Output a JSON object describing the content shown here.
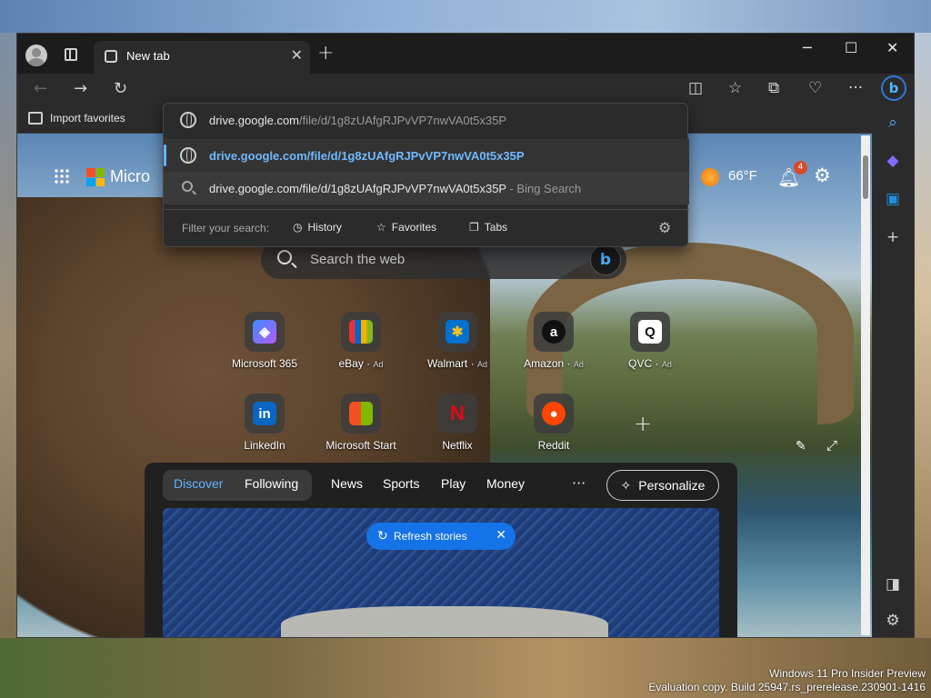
{
  "tab": {
    "title": "New tab"
  },
  "omnibox": {
    "typed_host": "drive.google.com",
    "typed_path": "/file/d/1g8zUAfgRJPvVP7nwVA0t5x35P",
    "suggestion_url": "drive.google.com/file/d/1g8zUAfgRJPvVP7nwVA0t5x35P",
    "search_text": "drive.google.com/file/d/1g8zUAfgRJPvVP7nwVA0t5x35P",
    "search_suffix": " - Bing Search",
    "filter_label": "Filter your search:",
    "filters": [
      "History",
      "Favorites",
      "Tabs"
    ]
  },
  "favorites_bar": {
    "import_label": "Import favorites"
  },
  "newtab": {
    "brand": "Micro",
    "temperature": "66°F",
    "notifications": "4",
    "search_placeholder": "Search the web",
    "quick_links": [
      {
        "label": "Microsoft 365",
        "ad": ""
      },
      {
        "label": "eBay",
        "ad": "Ad"
      },
      {
        "label": "Walmart",
        "ad": "Ad"
      },
      {
        "label": "Amazon",
        "ad": "Ad"
      },
      {
        "label": "QVC",
        "ad": "Ad"
      },
      {
        "label": "LinkedIn",
        "ad": ""
      },
      {
        "label": "Microsoft Start",
        "ad": ""
      },
      {
        "label": "Netflix",
        "ad": ""
      },
      {
        "label": "Reddit",
        "ad": ""
      }
    ]
  },
  "feed": {
    "tabs": [
      "Discover",
      "Following",
      "News",
      "Sports",
      "Play",
      "Money"
    ],
    "more": "···",
    "personalize": "Personalize",
    "refresh": "Refresh stories"
  },
  "watermark": {
    "line1": "Windows 11 Pro Insider Preview",
    "line2": "Evaluation copy. Build 25947.rs_prerelease.230901-1416"
  },
  "colors": {
    "accent": "#5fb6ff",
    "refresh_bg": "#1473e6"
  }
}
